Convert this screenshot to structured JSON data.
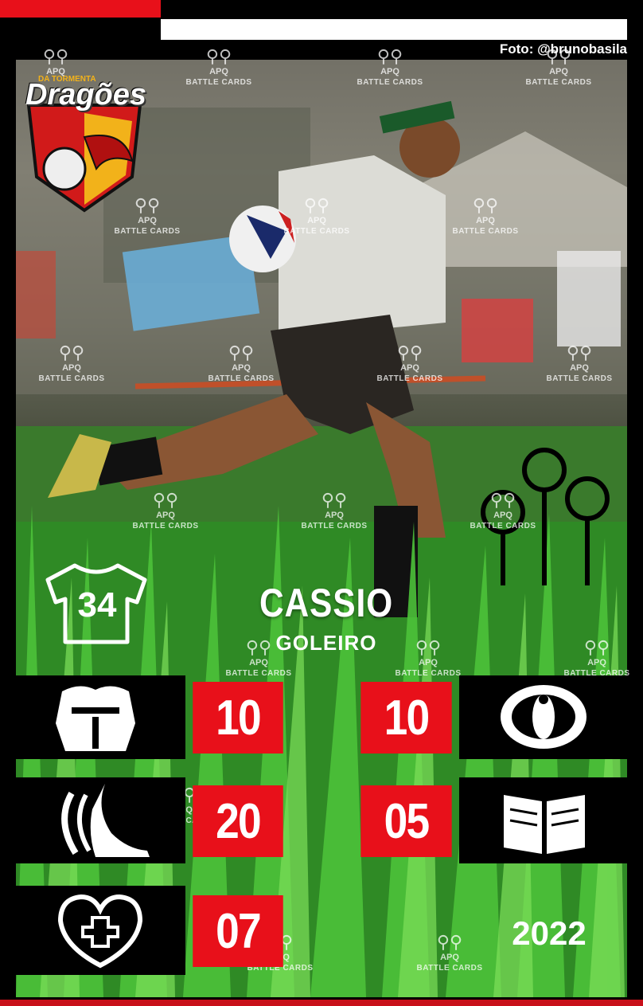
{
  "card": {
    "photo_credit": "Foto: @brunobasila",
    "team_logo": {
      "subtitle": "DA TORMENTA",
      "name": "Dragões"
    },
    "player": {
      "jersey_number": "34",
      "name": "CASSIO",
      "position": "GOLEIRO"
    },
    "stats": [
      {
        "icon": "armor-icon",
        "value": "10"
      },
      {
        "icon": "eye-icon",
        "value": "10"
      },
      {
        "icon": "speed-foot-icon",
        "value": "20"
      },
      {
        "icon": "book-icon",
        "value": "05"
      },
      {
        "icon": "health-heart-icon",
        "value": "07"
      }
    ],
    "year": "2022",
    "watermark": {
      "label": "APQ",
      "text": "BATTLE CARDS"
    },
    "colors": {
      "accent": "#e8101a",
      "background": "#000000",
      "grass": "#2f8a25"
    }
  }
}
